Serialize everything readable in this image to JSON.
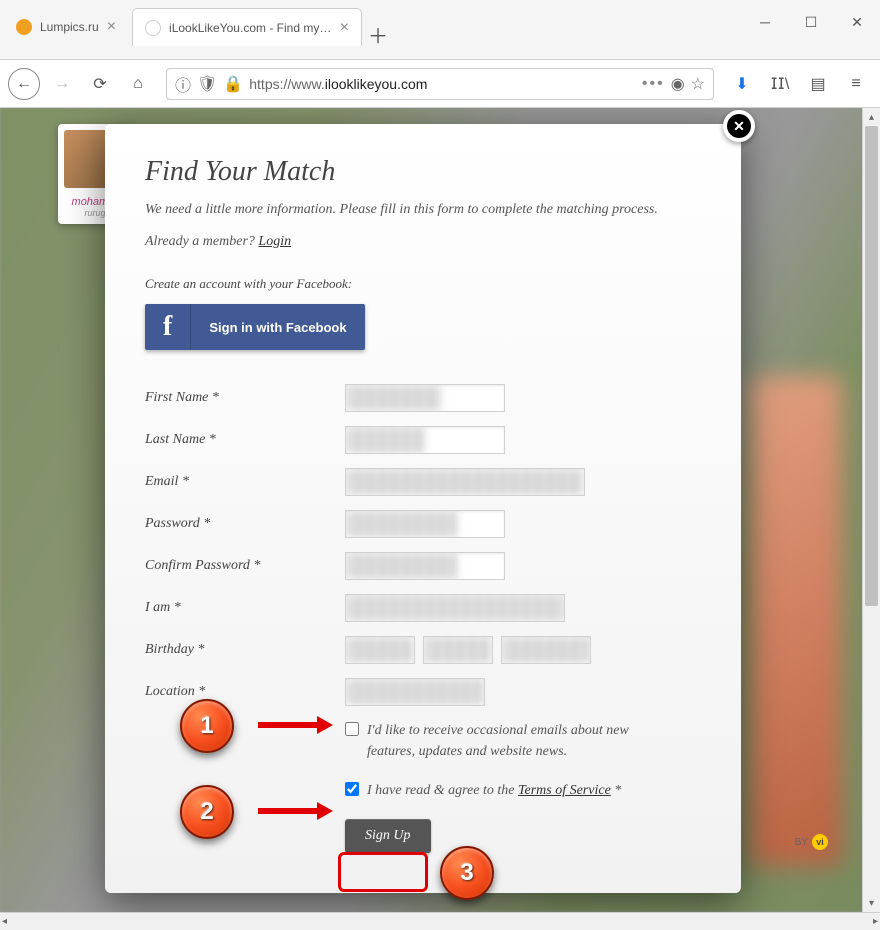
{
  "browser": {
    "tabs": [
      {
        "title": "Lumpics.ru",
        "favicon_color": "#f0a020",
        "active": false
      },
      {
        "title": "iLookLikeYou.com - Find my lo",
        "favicon_color": "#ffffff",
        "active": true
      }
    ],
    "url_prefix": "https://www.",
    "url_domain": "ilooklikeyou.com"
  },
  "profile_card": {
    "name": "mohamed",
    "sub": "rurugi"
  },
  "ad_badge_text": "BY",
  "modal": {
    "title": "Find Your Match",
    "subtitle": "We need a little more information. Please fill in this form to complete the matching process.",
    "member_prefix": "Already a member? ",
    "login_link": "Login",
    "fb_label": "Create an account with your Facebook:",
    "fb_button": "Sign in with Facebook",
    "fields": {
      "first_name": "First Name *",
      "last_name": "Last Name *",
      "email": "Email *",
      "password": "Password *",
      "confirm_password": "Confirm Password *",
      "i_am": "I am *",
      "birthday": "Birthday *",
      "location": "Location *"
    },
    "checkbox1": "I'd like to receive occasional emails about new features, updates and website news.",
    "checkbox2_prefix": "I have read & agree to the ",
    "checkbox2_link": "Terms of Service",
    "checkbox2_suffix": " *",
    "checkbox1_checked": false,
    "checkbox2_checked": true,
    "signup_button": "Sign Up"
  },
  "annotations": {
    "b1": "1",
    "b2": "2",
    "b3": "3"
  }
}
